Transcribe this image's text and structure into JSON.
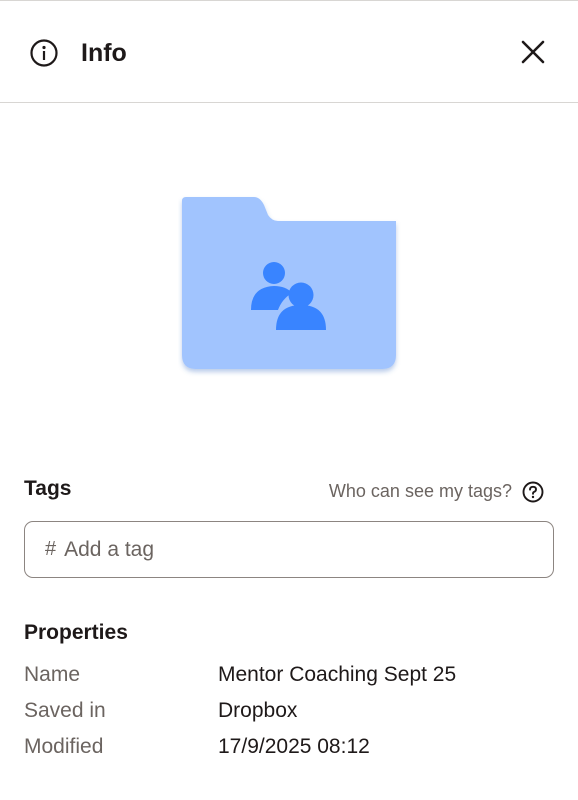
{
  "header": {
    "title": "Info",
    "info_icon": "info-circle-icon",
    "close_icon": "close-icon"
  },
  "preview": {
    "icon": "shared-folder-icon",
    "folder_color": "#a1c4fe",
    "figure_color": "#3984ff"
  },
  "tags": {
    "title": "Tags",
    "help_link": "Who can see my tags?",
    "help_icon": "question-circle-icon",
    "prefix": "#",
    "placeholder": "Add a tag",
    "value": ""
  },
  "properties": {
    "title": "Properties",
    "rows": [
      {
        "key": "Name",
        "value": "Mentor Coaching Sept 25"
      },
      {
        "key": "Saved in",
        "value": "Dropbox"
      },
      {
        "key": "Modified",
        "value": "17/9/2025 08:12"
      }
    ]
  },
  "colors": {
    "text_primary": "#1e1919",
    "text_secondary": "#6b6460",
    "border": "#d8d6d3"
  }
}
